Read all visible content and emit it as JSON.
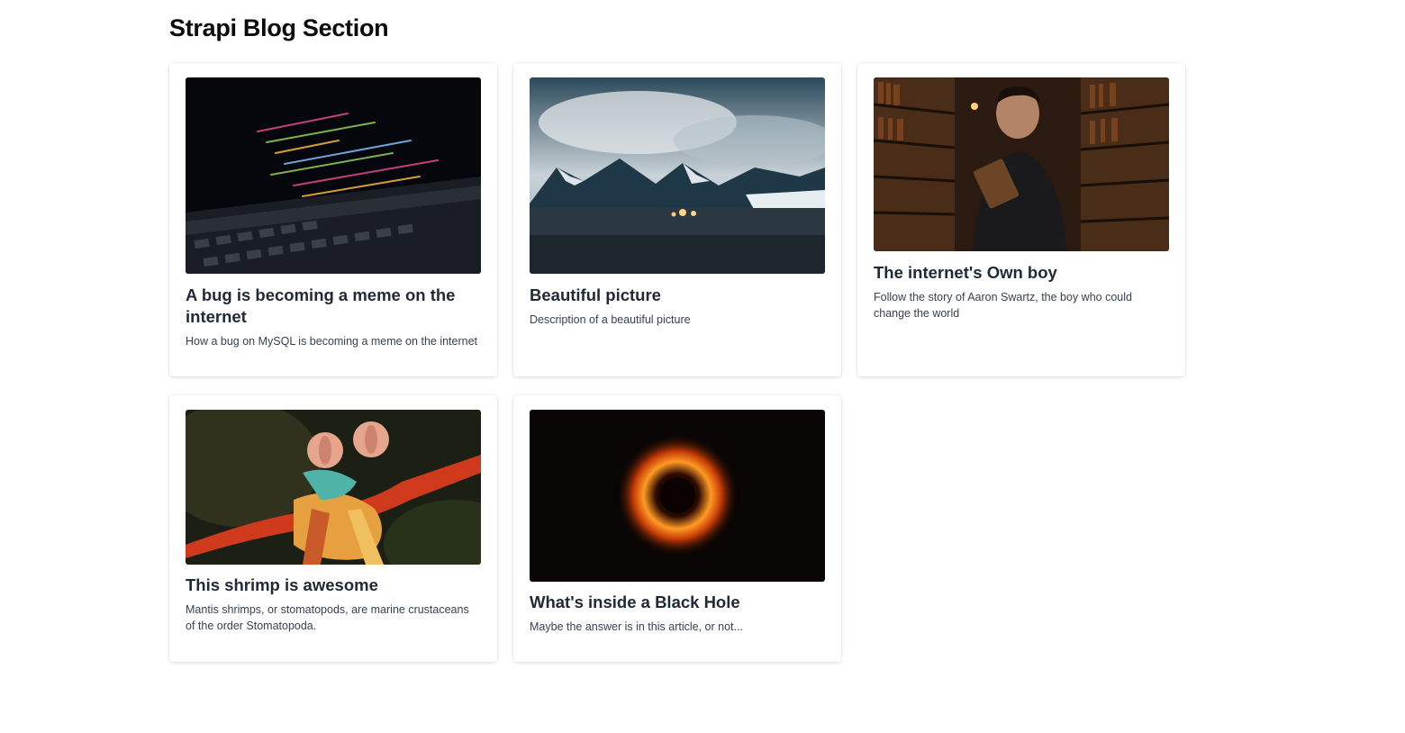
{
  "header": {
    "title": "Strapi Blog Section"
  },
  "articles": [
    {
      "title": "A bug is becoming a meme on the internet",
      "description": "How a bug on MySQL is becoming a meme on the internet"
    },
    {
      "title": "Beautiful picture",
      "description": "Description of a beautiful picture"
    },
    {
      "title": "The internet's Own boy",
      "description": "Follow the story of Aaron Swartz, the boy who could change the world"
    },
    {
      "title": "This shrimp is awesome",
      "description": "Mantis shrimps, or stomatopods, are marine crustaceans of the order Stomatopoda."
    },
    {
      "title": "What's inside a Black Hole",
      "description": "Maybe the answer is in this article, or not..."
    }
  ]
}
